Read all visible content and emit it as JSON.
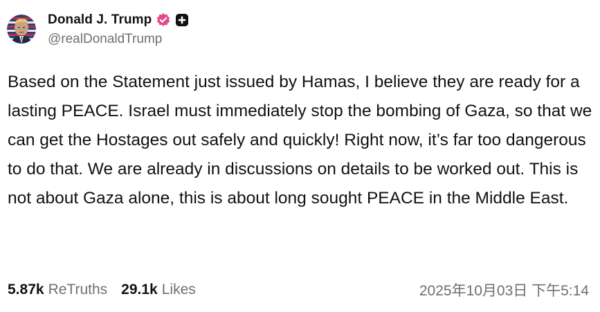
{
  "author": {
    "display_name": "Donald J. Trump",
    "handle": "@realDonaldTrump",
    "avatar_icon": "avatar-portrait-icon",
    "verified_icon": "verified-badge-icon",
    "verified_color": "#e4498a",
    "plus_icon": "plus-badge-icon"
  },
  "post": {
    "text": "Based on the Statement just issued by Hamas, I believe they are ready for a lasting PEACE. Israel must immediately stop the bombing of Gaza, so that we can get the Hostages out safely and quickly! Right now, it’s far too dangerous to do that. We are already in discussions on details to be worked out. This is not about Gaza alone, this is about long sought PEACE in the Middle East."
  },
  "stats": {
    "retruths_count": "5.87k",
    "retruths_label": "ReTruths",
    "likes_count": "29.1k",
    "likes_label": "Likes"
  },
  "timestamp": "2025年10月03日 下午5:14"
}
